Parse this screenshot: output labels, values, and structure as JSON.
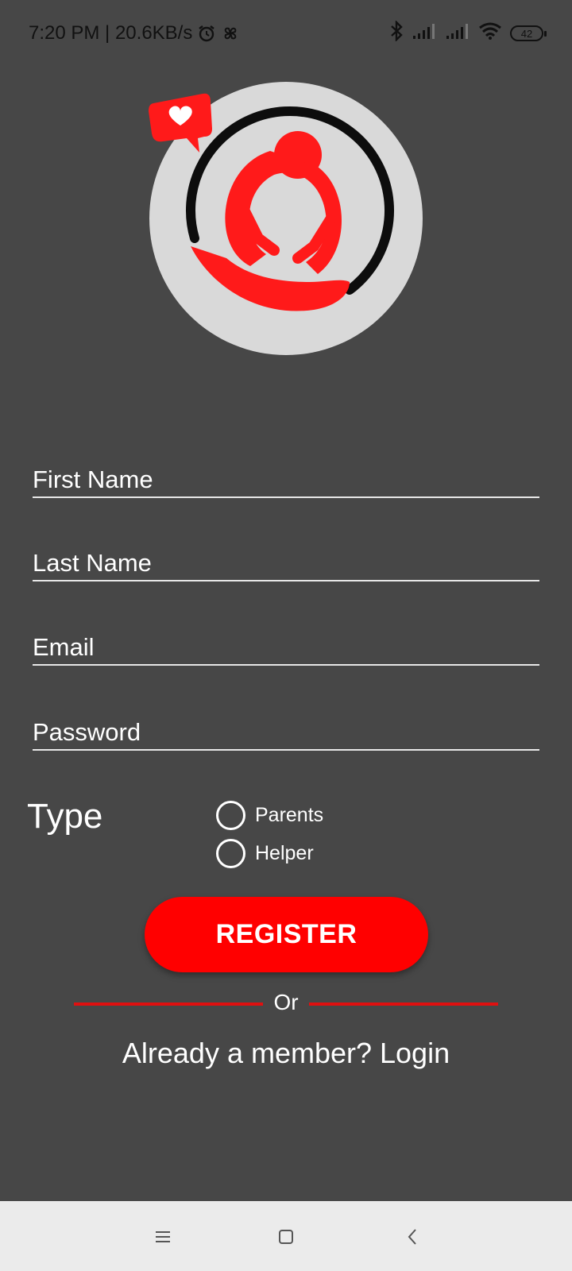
{
  "status_bar": {
    "time_speed": "7:20 PM | 20.6KB/s",
    "battery": "42",
    "icons": [
      "alarm-icon",
      "pinwheel-icon",
      "bluetooth-icon",
      "signal-icon",
      "signal-icon",
      "wifi-icon",
      "battery-icon"
    ]
  },
  "logo": {
    "icon": "mother-child-heart-logo",
    "colors": {
      "circle": "#d9d9d9",
      "ring": "#0d0d0d",
      "accent": "#ff1a1a"
    }
  },
  "form": {
    "first_name": {
      "placeholder": "First Name",
      "value": ""
    },
    "last_name": {
      "placeholder": "Last Name",
      "value": ""
    },
    "email": {
      "placeholder": "Email",
      "value": ""
    },
    "password": {
      "placeholder": "Password",
      "value": ""
    },
    "type_label": "Type",
    "type_options": [
      "Parents",
      "Helper"
    ],
    "register_label": "REGISTER",
    "or_label": "Or",
    "login_prompt": "Already a member? Login"
  },
  "nav_bar": {
    "icons": [
      "menu-icon",
      "home-square-icon",
      "back-chevron-icon"
    ]
  },
  "colors": {
    "background": "#474747",
    "accent": "#ff0000",
    "nav_background": "#ebebeb"
  }
}
